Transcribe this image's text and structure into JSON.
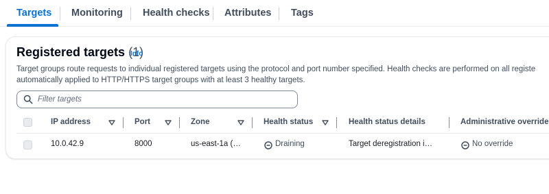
{
  "tabs": [
    {
      "label": "Targets",
      "active": true
    },
    {
      "label": "Monitoring",
      "active": false
    },
    {
      "label": "Health checks",
      "active": false
    },
    {
      "label": "Attributes",
      "active": false
    },
    {
      "label": "Tags",
      "active": false
    }
  ],
  "panel": {
    "title": "Registered targets",
    "count": "(1)",
    "info": "Info",
    "description_line1": "Target groups route requests to individual registered targets using the protocol and port number specified. Health checks are performed on all registe",
    "description_line2": "automatically applied to HTTP/HTTPS target groups with at least 3 healthy targets."
  },
  "search": {
    "placeholder": "Filter targets",
    "value": ""
  },
  "table": {
    "columns": [
      "IP address",
      "Port",
      "Zone",
      "Health status",
      "Health status details",
      "Administrative override"
    ],
    "rows": [
      {
        "ip": "10.0.42.9",
        "port": "8000",
        "zone": "us-east-1a (…",
        "health_status": "Draining",
        "health_details": "Target deregistration i…",
        "override": "No override"
      }
    ]
  },
  "colors": {
    "accent": "#0972d3",
    "text": "#16191f",
    "muted": "#414d5c",
    "border": "#e9ebed"
  },
  "icons": {
    "search": "search-icon",
    "sort": "caret-down-icon",
    "draining": "minus-circle-icon",
    "no_override": "minus-circle-icon"
  }
}
